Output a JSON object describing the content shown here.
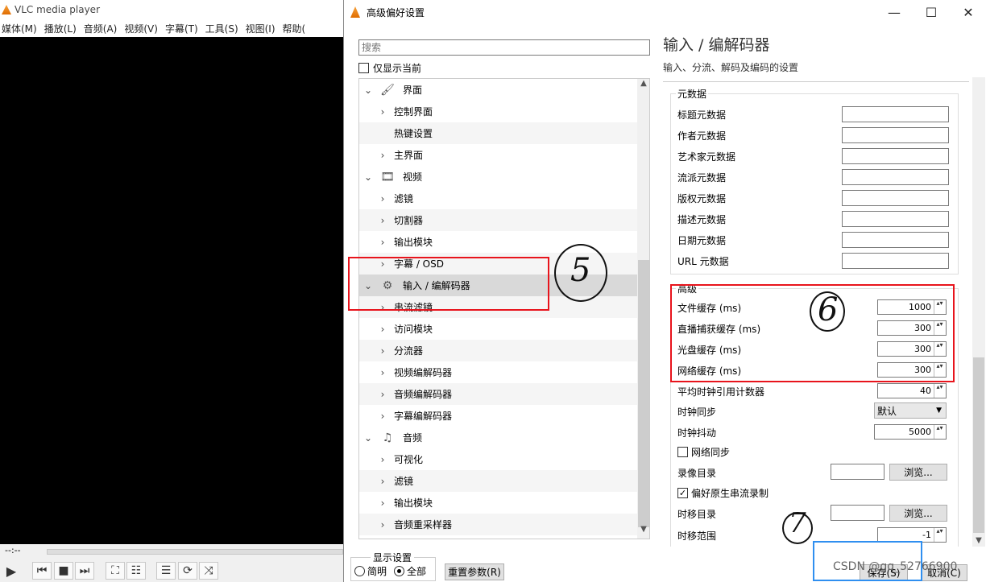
{
  "vlc": {
    "title": "VLC media player",
    "menu": [
      "媒体(M)",
      "播放(L)",
      "音频(A)",
      "视频(V)",
      "字幕(T)",
      "工具(S)",
      "视图(I)",
      "帮助("
    ],
    "time_left": "--:--",
    "controls": [
      "play-icon",
      "prev-icon",
      "stop-icon",
      "next-icon",
      "fullscreen-icon",
      "equalizer-icon",
      "playlist-icon",
      "loop-icon",
      "shuffle-icon"
    ]
  },
  "dialog": {
    "title": "高级偏好设置",
    "search_placeholder": "搜索",
    "show_current_label": "仅显示当前",
    "tree": [
      {
        "label": "界面",
        "level": 0,
        "expanded": true,
        "icon": "paint-roller-icon"
      },
      {
        "label": "控制界面",
        "level": 1,
        "arrow": true
      },
      {
        "label": "热键设置",
        "level": 1,
        "arrow": false
      },
      {
        "label": "主界面",
        "level": 1,
        "arrow": true
      },
      {
        "label": "视频",
        "level": 0,
        "expanded": true,
        "icon": "film-icon"
      },
      {
        "label": "滤镜",
        "level": 1,
        "arrow": true
      },
      {
        "label": "切割器",
        "level": 1,
        "arrow": true
      },
      {
        "label": "输出模块",
        "level": 1,
        "arrow": true
      },
      {
        "label": "字幕 / OSD",
        "level": 1,
        "arrow": true
      },
      {
        "label": "输入 / 编解码器",
        "level": 0,
        "expanded": true,
        "icon": "codec-icon",
        "selected": true
      },
      {
        "label": "串流滤镜",
        "level": 1,
        "arrow": true
      },
      {
        "label": "访问模块",
        "level": 1,
        "arrow": true
      },
      {
        "label": "分流器",
        "level": 1,
        "arrow": true
      },
      {
        "label": "视频编解码器",
        "level": 1,
        "arrow": true
      },
      {
        "label": "音频编解码器",
        "level": 1,
        "arrow": true
      },
      {
        "label": "字幕编解码器",
        "level": 1,
        "arrow": true
      },
      {
        "label": "音频",
        "level": 0,
        "expanded": true,
        "icon": "music-note-icon"
      },
      {
        "label": "可视化",
        "level": 1,
        "arrow": true
      },
      {
        "label": "滤镜",
        "level": 1,
        "arrow": true
      },
      {
        "label": "输出模块",
        "level": 1,
        "arrow": true
      },
      {
        "label": "音频重采样器",
        "level": 1,
        "arrow": true
      }
    ],
    "panel_title": "输入 / 编解码器",
    "panel_subtitle": "输入、分流、解码及编码的设置",
    "metadata_group": "元数据",
    "metadata_fields": [
      "标题元数据",
      "作者元数据",
      "艺术家元数据",
      "流派元数据",
      "版权元数据",
      "描述元数据",
      "日期元数据",
      "URL 元数据"
    ],
    "advanced_group": "高级",
    "advanced_spins": [
      {
        "label": "文件缓存 (ms)",
        "value": "1000"
      },
      {
        "label": "直播捕获缓存 (ms)",
        "value": "300"
      },
      {
        "label": "光盘缓存 (ms)",
        "value": "300"
      },
      {
        "label": "网络缓存 (ms)",
        "value": "300"
      },
      {
        "label": "平均时钟引用计数器",
        "value": "40"
      }
    ],
    "clock_sync_label": "时钟同步",
    "clock_sync_value": "默认",
    "clock_jitter_label": "时钟抖动",
    "clock_jitter_value": "5000",
    "network_sync_label": "网络同步",
    "record_dir_label": "录像目录",
    "browse_label": "浏览...",
    "prefer_raw_label": "偏好原生串流录制",
    "timeshift_dir_label": "时移目录",
    "timeshift_range_label": "时移范围",
    "timeshift_range_value": "-1",
    "show_settings_label": "显示设置",
    "simple_label": "简明",
    "all_label": "全部",
    "reset_label": "重置参数(R)",
    "save_label": "保存(S)",
    "cancel_label": "取消(C)",
    "annotations": {
      "five": "5",
      "six": "6",
      "seven": "7"
    },
    "watermark": "CSDN @qq_52766900"
  }
}
